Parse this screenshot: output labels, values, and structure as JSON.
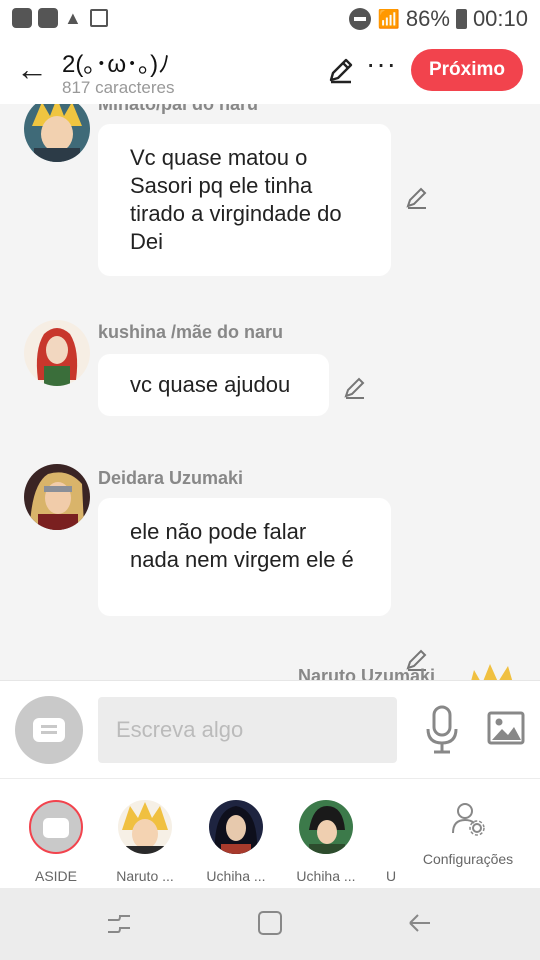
{
  "status_bar": {
    "battery": "86%",
    "time": "00:10"
  },
  "header": {
    "title": "2(｡･ω･｡)ﾉ",
    "char_count": "817 caracteres",
    "next_label": "Próximo"
  },
  "messages": [
    {
      "name": "Minato/pai do naru",
      "text": "Vc quase matou o Sasori pq ele tinha tirado a virgindade do Dei"
    },
    {
      "name": "kushina /mãe do naru",
      "text": "vc quase ajudou"
    },
    {
      "name": "Deidara Uzumaki",
      "text": "ele não pode falar nada nem virgem ele é"
    },
    {
      "name": "Naruto Uzumaki"
    }
  ],
  "composer": {
    "placeholder": "Escreva algo"
  },
  "characters": [
    {
      "label": "ASIDE"
    },
    {
      "label": "Naruto ..."
    },
    {
      "label": "Uchiha ..."
    },
    {
      "label": "Uchiha ..."
    },
    {
      "label": "U"
    }
  ],
  "settings_label": "Configurações",
  "colors": {
    "accent": "#f2434d",
    "background": "#f4f4f4"
  }
}
